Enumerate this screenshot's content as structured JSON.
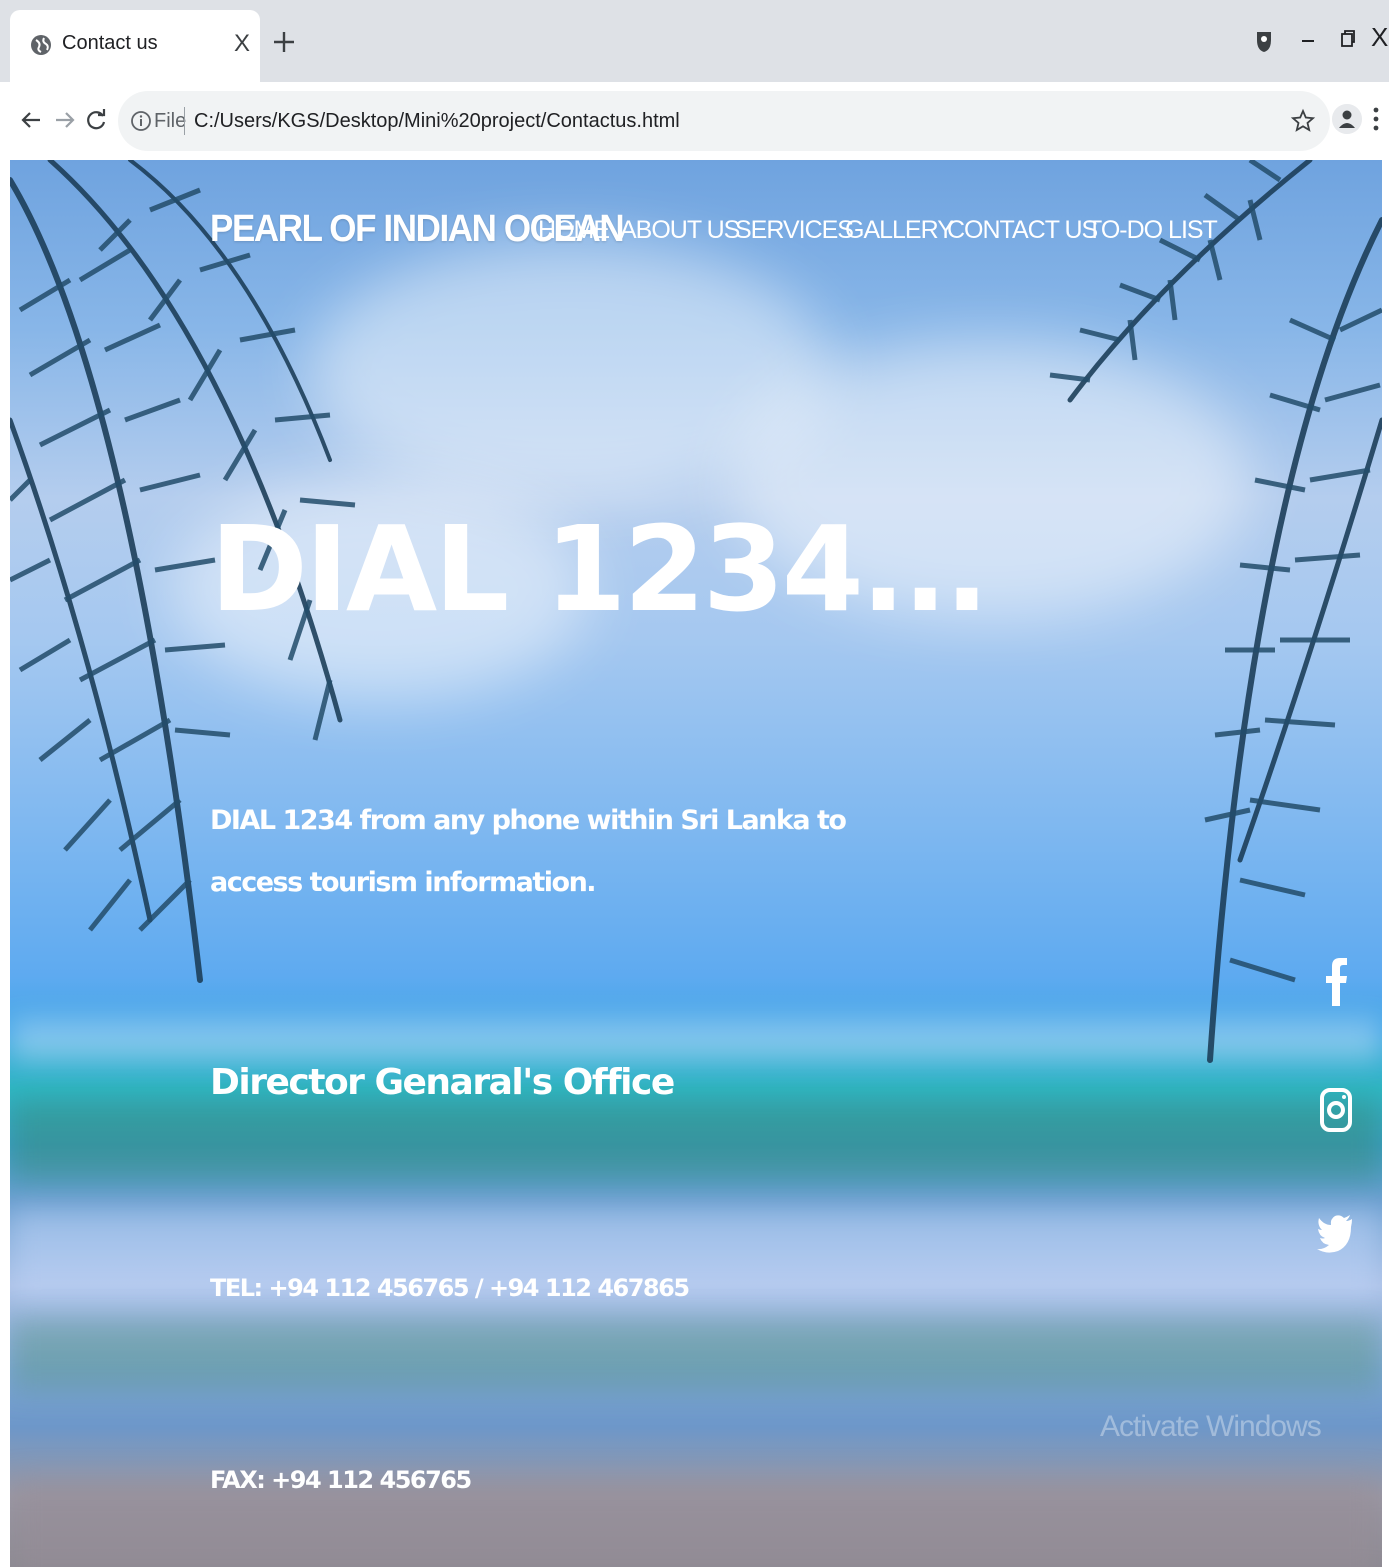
{
  "browser": {
    "tab_title": "Contact us",
    "tab_close_label": "X",
    "address": {
      "scheme_label": "File",
      "url": "C:/Users/KGS/Desktop/Mini%20project/Contactus.html"
    },
    "window_close_label": "X"
  },
  "site": {
    "brand": "PEARL OF INDIAN OCEAN",
    "nav": [
      {
        "label": "HOME"
      },
      {
        "label": "ABOUT US"
      },
      {
        "label": "SERVICES"
      },
      {
        "label": "GALLERY"
      },
      {
        "label": "CONTACT US"
      },
      {
        "label": "TO-DO LIST"
      }
    ]
  },
  "contact": {
    "hero_title": "DIAL 1234...",
    "hero_description": "DIAL 1234 from any phone within Sri Lanka to access tourism information.",
    "office_title": "Director Genaral's Office",
    "tel": "TEL: +94 112 456765 / +94 112 467865",
    "fax": "FAX: +94 112 456765"
  },
  "social": [
    {
      "icon": "facebook-icon"
    },
    {
      "icon": "instagram-icon"
    },
    {
      "icon": "twitter-icon"
    }
  ],
  "os_overlay": {
    "watermark": "Activate Windows"
  },
  "colors": {
    "chrome_bg": "#dee1e6",
    "text_light": "#ffffff",
    "sky": "#7db7f0",
    "sea": "#2fb6c4"
  }
}
